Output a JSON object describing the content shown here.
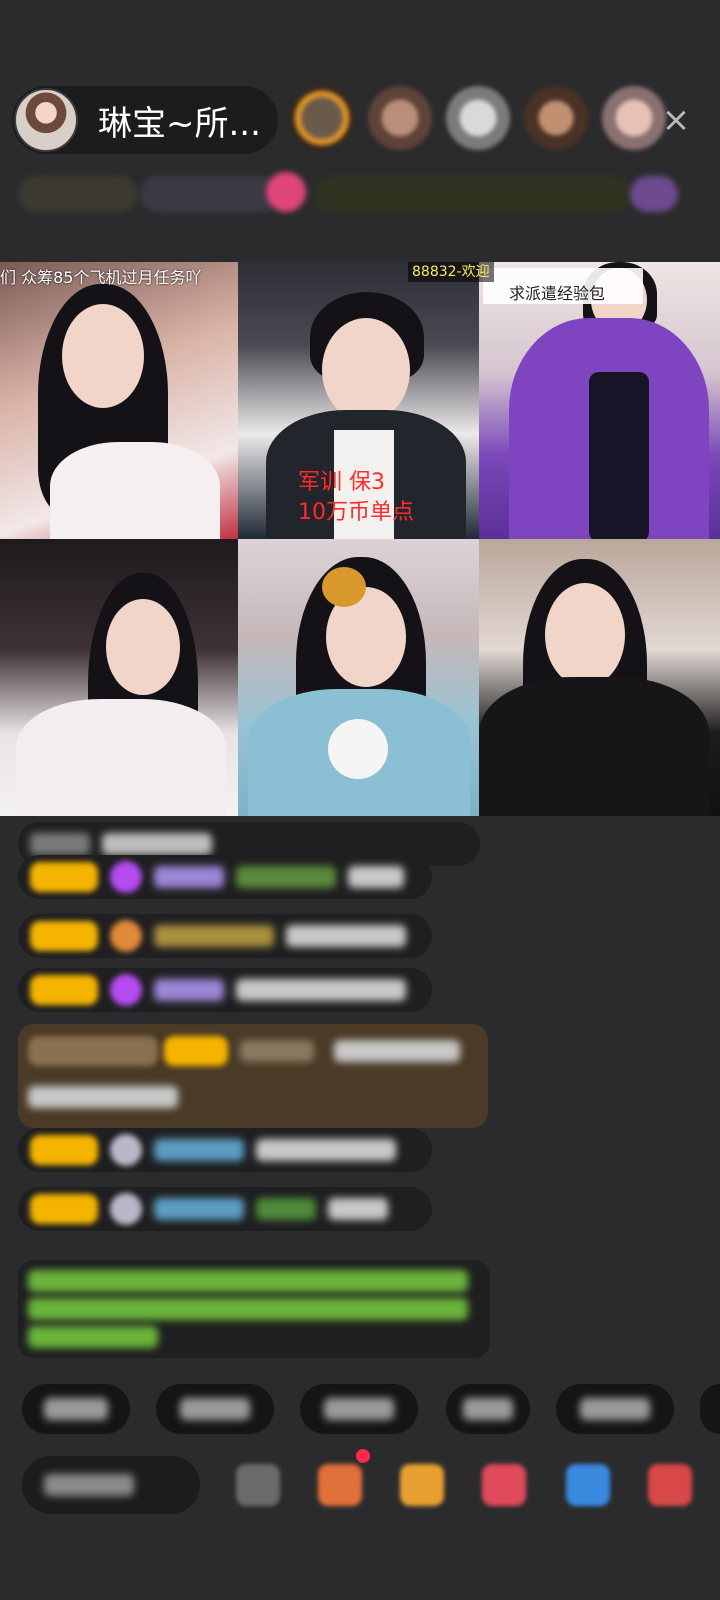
{
  "header": {
    "host_name": "琳宝~所...",
    "close_icon": "×"
  },
  "tiles": {
    "t1_caption": "们 众筹85个飞机过月任务吖",
    "t2_caption_line1": "军训  保3",
    "t2_caption_line2": "10万币单点",
    "t3_badge": "88832-欢迎",
    "t3_banner_text": "求派遣经验包"
  },
  "colors": {
    "background": "#2b2b2d",
    "accent_red": "#ff2b2b",
    "badge_yellow": "#ffe760",
    "chat_badge": "#f4b400",
    "vip_purple": "#b44cf0"
  }
}
